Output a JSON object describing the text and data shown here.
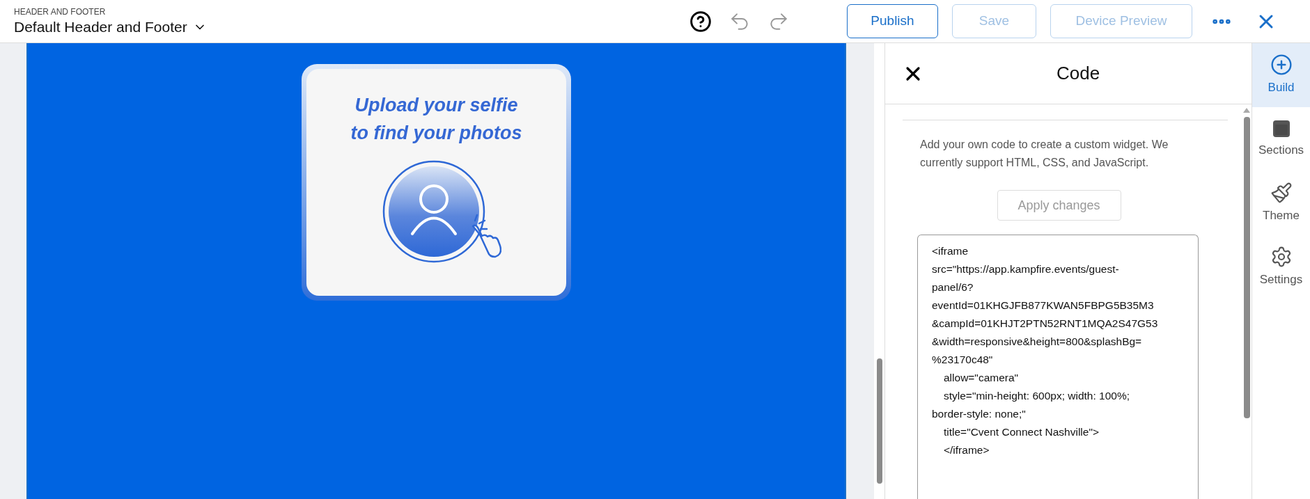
{
  "header": {
    "eyebrow": "HEADER AND FOOTER",
    "title": "Default Header and Footer",
    "buttons": [
      {
        "label": "Publish",
        "disabled": false
      },
      {
        "label": "Save",
        "disabled": true
      },
      {
        "label": "Device Preview",
        "disabled": true
      }
    ]
  },
  "canvas": {
    "card": {
      "title_lines": [
        "Upload your selfie",
        "to find your photos"
      ]
    }
  },
  "panel": {
    "title": "Code",
    "description": "Add your own code to create a custom widget. We currently support HTML, CSS, and JavaScript.",
    "apply_button": {
      "label": "Apply changes",
      "disabled": true
    },
    "code_lines": [
      {
        "text": "<iframe",
        "indented": false
      },
      {
        "text": "src=\"https://app.kampfire.events/guest-",
        "indented": false
      },
      {
        "text": "panel/6?",
        "indented": false
      },
      {
        "text": "eventId=01KHGJFB877KWAN5FBPG5B35M3",
        "indented": false
      },
      {
        "text": "&campId=01KHJT2PTN52RNT1MQA2S47G53",
        "indented": false
      },
      {
        "text": "&width=responsive&height=800&splashBg=",
        "indented": false
      },
      {
        "text": "%23170c48\"",
        "indented": false
      },
      {
        "text": "allow=\"camera\"",
        "indented": true
      },
      {
        "text": "style=\"min-height: 600px; width: 100%;",
        "indented": true
      },
      {
        "text": "border-style: none;\"",
        "indented": false
      },
      {
        "text": "title=\"Cvent Connect Nashville\">",
        "indented": true
      },
      {
        "text": "</iframe>",
        "indented": true
      }
    ]
  },
  "rail": [
    {
      "kind": "build",
      "label": "Build",
      "selected": true
    },
    {
      "kind": "sections",
      "label": "Sections",
      "selected": false
    },
    {
      "kind": "theme",
      "label": "Theme",
      "selected": false
    },
    {
      "kind": "settings",
      "label": "Settings",
      "selected": false
    }
  ]
}
